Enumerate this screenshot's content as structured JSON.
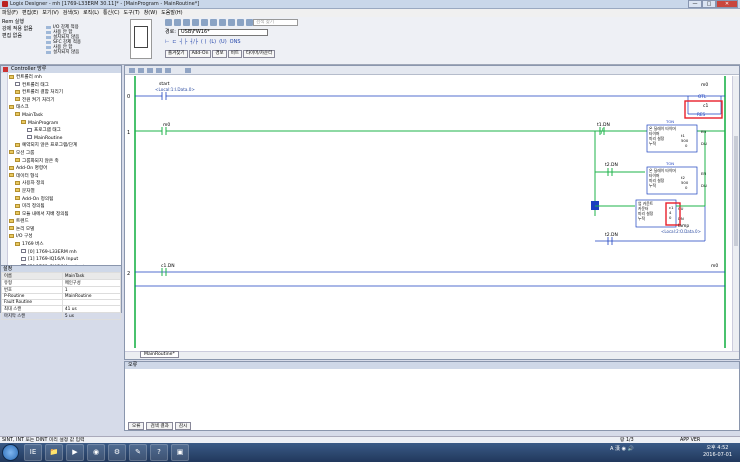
{
  "window": {
    "title": "Logix Designer - mh [1769-L33ERM 30.11]* - [MainProgram - MainRoutine*]",
    "controls": [
      "—",
      "□",
      "✕"
    ]
  },
  "menu": [
    "파일(F)",
    "편집(E)",
    "보기(V)",
    "검색(S)",
    "로직(L)",
    "통신(C)",
    "도구(T)",
    "창(W)",
    "도움말(H)"
  ],
  "toolbar": {
    "left_rows": [
      "Rem 실행",
      "강제 적용 없음",
      "편집 없음"
    ],
    "mid_rows": [
      "I/O 강제 적용",
      "사용 안 함",
      "설치되지 않음",
      "SFC 강제 적용",
      "사용 안 함",
      "설치되지 않음"
    ],
    "search_placeholder": "검색 찾기",
    "path_label": "경로:",
    "path_value": "USB\\FW16*",
    "instruction_tabs": [
      "즐겨찾기",
      "Add-On",
      "경보",
      "비트",
      "타이머/카운터"
    ]
  },
  "organizer": {
    "title": "Controller 망루",
    "tree": [
      {
        "label": "컨트롤러 mh",
        "depth": 0,
        "icon": "folder"
      },
      {
        "label": "컨트롤러 태그",
        "depth": 1,
        "icon": "doc"
      },
      {
        "label": "컨트롤러 결함 처리기",
        "depth": 1,
        "icon": "folder"
      },
      {
        "label": "전원 켜기 처리기",
        "depth": 1,
        "icon": "folder"
      },
      {
        "label": "태스크",
        "depth": 0,
        "icon": "folder"
      },
      {
        "label": "MainTask",
        "depth": 1,
        "icon": "folder"
      },
      {
        "label": "MainProgram",
        "depth": 2,
        "icon": "folder"
      },
      {
        "label": "프로그램 태그",
        "depth": 3,
        "icon": "doc"
      },
      {
        "label": "MainRoutine",
        "depth": 3,
        "icon": "doc"
      },
      {
        "label": "예약되지 않은 프로그램/단계",
        "depth": 1,
        "icon": "folder"
      },
      {
        "label": "모션 그룹",
        "depth": 0,
        "icon": "folder"
      },
      {
        "label": "그룹화되지 않은 축",
        "depth": 1,
        "icon": "folder"
      },
      {
        "label": "Add-On 명령어",
        "depth": 0,
        "icon": "folder"
      },
      {
        "label": "데이터 형식",
        "depth": 0,
        "icon": "folder"
      },
      {
        "label": "사용자 정의",
        "depth": 1,
        "icon": "folder"
      },
      {
        "label": "문자열",
        "depth": 1,
        "icon": "folder"
      },
      {
        "label": "Add-On 정의됨",
        "depth": 1,
        "icon": "folder"
      },
      {
        "label": "미리 정의됨",
        "depth": 1,
        "icon": "folder"
      },
      {
        "label": "모듈 내에서 지배 정의됨",
        "depth": 1,
        "icon": "folder"
      },
      {
        "label": "트렌드",
        "depth": 0,
        "icon": "folder"
      },
      {
        "label": "논리 모델",
        "depth": 0,
        "icon": "folder"
      },
      {
        "label": "I/O 구성",
        "depth": 0,
        "icon": "folder"
      },
      {
        "label": "1769 버스",
        "depth": 1,
        "icon": "folder"
      },
      {
        "label": "[0] 1769-L33ERM mh",
        "depth": 2,
        "icon": "doc"
      },
      {
        "label": "[1] 1769-IQ16/A Input",
        "depth": 2,
        "icon": "doc"
      },
      {
        "label": "[2] 1769-OW16/A output",
        "depth": 2,
        "icon": "doc"
      },
      {
        "label": "이더넷",
        "depth": 1,
        "icon": "folder"
      },
      {
        "label": "1769-L33ERM mh",
        "depth": 2,
        "icon": "doc"
      }
    ]
  },
  "properties": {
    "title": "설정",
    "header": [
      "이름",
      "MainTask"
    ],
    "rows": [
      [
        "유형",
        "메인구성"
      ],
      [
        "번호",
        "1"
      ],
      [
        "P-Routine",
        "MainRoutine"
      ],
      [
        "Fault Routine",
        ""
      ],
      [
        "최대 스캔",
        "41 us"
      ],
      [
        "마지막 스캔",
        "5 us"
      ]
    ]
  },
  "ladder": {
    "rungs": [
      {
        "num": "0",
        "contact": {
          "tag": "start",
          "desc": "<Local:1:I.Data.0>"
        },
        "coil": {
          "tag": "m0",
          "type": "OTL"
        },
        "coil2": {
          "tag": "c1",
          "type": "RES"
        }
      },
      {
        "num": "1",
        "contact": {
          "tag": "m0",
          "desc": ""
        }
      },
      {
        "num": "2",
        "contact": {
          "tag": "c1.DN",
          "desc": ""
        },
        "coil": {
          "tag": "m0",
          "type": "OTU"
        }
      }
    ],
    "branch_labels": {
      "t1dn": "t1.DN",
      "t2dn": "t2.DN",
      "t2dn_b": "t2.DN",
      "lamp": "lamp",
      "lamp_desc": "<Local:2:O.Data.0>"
    },
    "timer1": {
      "op": "TON",
      "name": "온 딜레이 타이머",
      "l2": "타이머",
      "l3": "미리 설정",
      "l4": "누적",
      "tag": "t1",
      "preset": "500",
      "acc": "0",
      "en": "EN",
      "dn": "DN"
    },
    "timer2": {
      "op": "TON",
      "name": "온 딜레이 타이머",
      "l2": "타이머",
      "l3": "미리 설정",
      "l4": "누적",
      "tag": "t2",
      "preset": "500",
      "acc": "0",
      "en": "EN",
      "dn": "DN"
    },
    "counter": {
      "op": "CTU",
      "name": "업 카운트",
      "l2": "카운터",
      "l3": "미리 설정",
      "l4": "누적",
      "tag": "c1",
      "preset": "4",
      "acc": "0",
      "cu": "CU",
      "dn": "DN"
    },
    "routine_tab": "MainRoutine*",
    "highlight_color": "#e8202a",
    "energized_color": "#1db34a"
  },
  "output": {
    "title": "오류",
    "tabs": [
      "오류",
      "검색 결과",
      "감시"
    ]
  },
  "statusbar": {
    "message": "SINT, INT 또는 DINT 미리 설정 값 입력",
    "page": "랑 1/3",
    "app": "APP",
    "ver": "VER"
  },
  "taskbar": {
    "apps": [
      "IE",
      "📁",
      "▶",
      "◉",
      "⚙",
      "✎",
      "?",
      "▣"
    ],
    "tray": "A 漢 ◉ 🔊",
    "time": "오후 4:52",
    "date": "2016-07-01"
  }
}
